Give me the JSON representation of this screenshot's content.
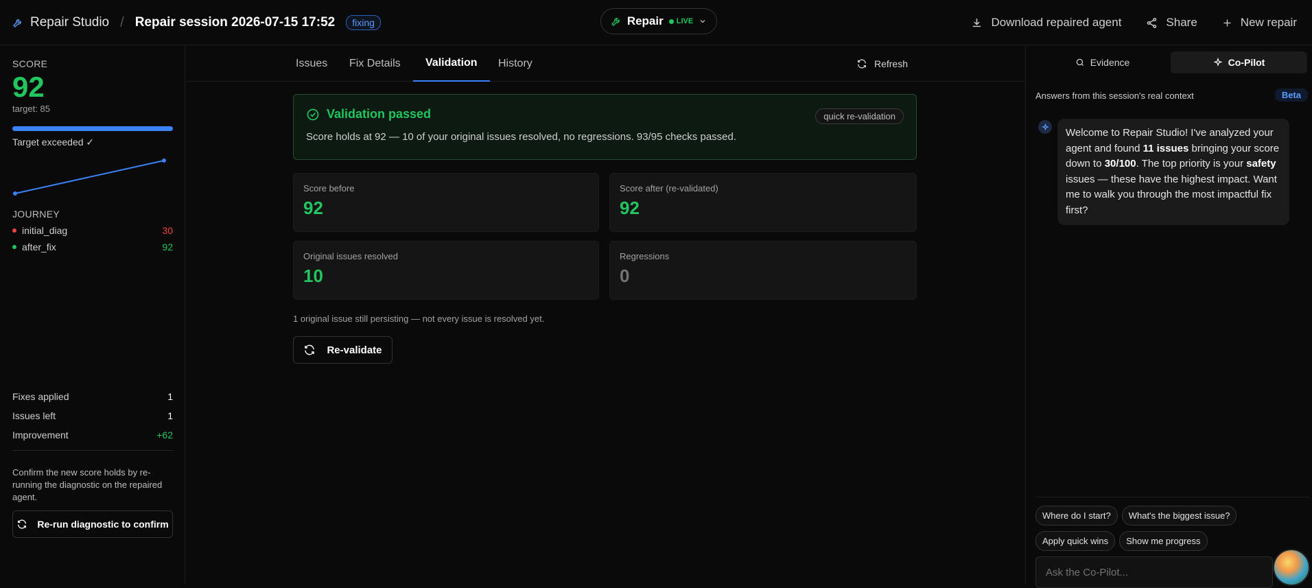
{
  "header": {
    "brand": "Repair Studio",
    "separator": "/",
    "session_title": "Repair session 2026-07-15 17:52",
    "status_badge": "fixing",
    "mode": "Repair",
    "live": "LIVE",
    "actions": {
      "download": "Download repaired agent",
      "share": "Share",
      "new_repair": "New repair"
    }
  },
  "sidebar": {
    "score_label": "SCORE",
    "score_value": "92",
    "target_text": "target: 85",
    "progress_fraction": 1.0,
    "target_status": "Target exceeded ✓",
    "journey_label": "JOURNEY",
    "journey": [
      {
        "name": "initial_diag",
        "value": "30",
        "color": "#ef4444"
      },
      {
        "name": "after_fix",
        "value": "92",
        "color": "#22c55e"
      }
    ],
    "stats": [
      {
        "label": "Fixes applied",
        "value": "1"
      },
      {
        "label": "Issues left",
        "value": "1"
      },
      {
        "label": "Improvement",
        "value": "+62"
      }
    ],
    "confirm_text": "Confirm the new score holds by re-running the diagnostic on the repaired agent.",
    "rerun_button": "Re-run diagnostic to confirm"
  },
  "main": {
    "tabs": [
      "Issues",
      "Fix Details",
      "Validation",
      "History"
    ],
    "active_tab": "Validation",
    "refresh_label": "Refresh",
    "banner": {
      "title": "Validation passed",
      "tag": "quick re-validation",
      "message": "Score holds at 92 — 10 of your original issues resolved, no regressions. 93/95 checks passed."
    },
    "cards": [
      {
        "label": "Score before",
        "value": "92"
      },
      {
        "label": "Score after (re-validated)",
        "value": "92"
      },
      {
        "label": "Original issues resolved",
        "value": "10"
      },
      {
        "label": "Regressions",
        "value": "0"
      }
    ],
    "persist_note": "1 original issue still persisting — not every issue is resolved yet.",
    "revalidate_button": "Re-validate"
  },
  "copilot": {
    "tabs": {
      "evidence": "Evidence",
      "copilot": "Co-Pilot"
    },
    "context_note": "Answers from this session's real context",
    "beta": "Beta",
    "message": {
      "p1": "Welcome to Repair Studio! I've analyzed your agent and found ",
      "b1": "11 issues",
      "p2": " bringing your score down to ",
      "b2": "30/100",
      "p3": ". The top priority is your ",
      "b3": "safety",
      "p4": " issues — these have the highest impact. Want me to walk you through the most impactful fix first?"
    },
    "chips": [
      "Where do I start?",
      "What's the biggest issue?",
      "Apply quick wins",
      "Show me progress"
    ],
    "input_placeholder": "Ask the Co-Pilot..."
  },
  "colors": {
    "accent": "#3b82f6",
    "success": "#22c55e",
    "danger": "#ef4444",
    "badge_blue": "#5b9bff"
  }
}
